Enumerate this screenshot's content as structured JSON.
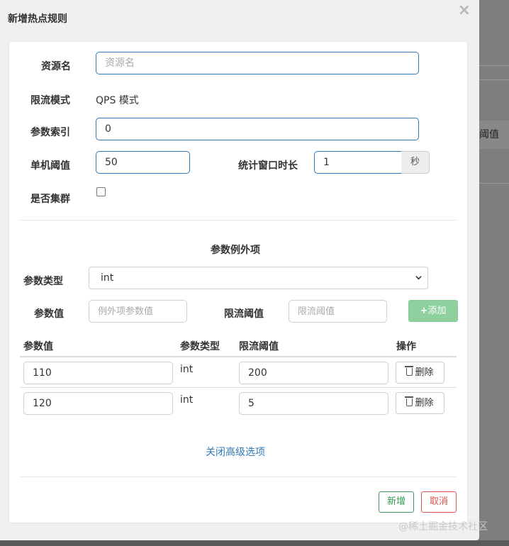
{
  "dialog": {
    "title": "新增热点规则",
    "close_glyph": "×"
  },
  "form": {
    "resource_name": {
      "label": "资源名",
      "value": "",
      "placeholder": "资源名"
    },
    "limit_mode": {
      "label": "限流模式",
      "value": "QPS 模式"
    },
    "param_index": {
      "label": "参数索引",
      "value": "0"
    },
    "threshold": {
      "label": "单机阈值",
      "value": "50"
    },
    "window": {
      "label": "统计窗口时长",
      "value": "1",
      "unit": "秒"
    },
    "cluster": {
      "label": "是否集群",
      "checked": false
    }
  },
  "exceptions": {
    "section_title": "参数例外项",
    "param_type": {
      "label": "参数类型",
      "selected": "int"
    },
    "param_value": {
      "label": "参数值",
      "placeholder": "例外项参数值"
    },
    "limit_threshold": {
      "label": "限流阈值",
      "placeholder": "限流阈值"
    },
    "add_button": "添加",
    "add_icon": "plus-icon",
    "table": {
      "headers": [
        "参数值",
        "参数类型",
        "限流阈值",
        "操作"
      ],
      "rows": [
        {
          "value": "110",
          "type": "int",
          "threshold": "200",
          "action": "删除"
        },
        {
          "value": "120",
          "type": "int",
          "threshold": "5",
          "action": "删除"
        }
      ]
    },
    "toggle_link": "关闭高级选项"
  },
  "footer": {
    "submit": "新增",
    "cancel": "取消"
  },
  "background": {
    "cell_text": "阈值"
  },
  "watermark": "@稀土掘金技术社区",
  "colors": {
    "primary_border": "#2e78b7",
    "add_button": "#8fd19e",
    "submit": "#2f9a4b",
    "cancel": "#d9534f",
    "link": "#337ab7"
  }
}
